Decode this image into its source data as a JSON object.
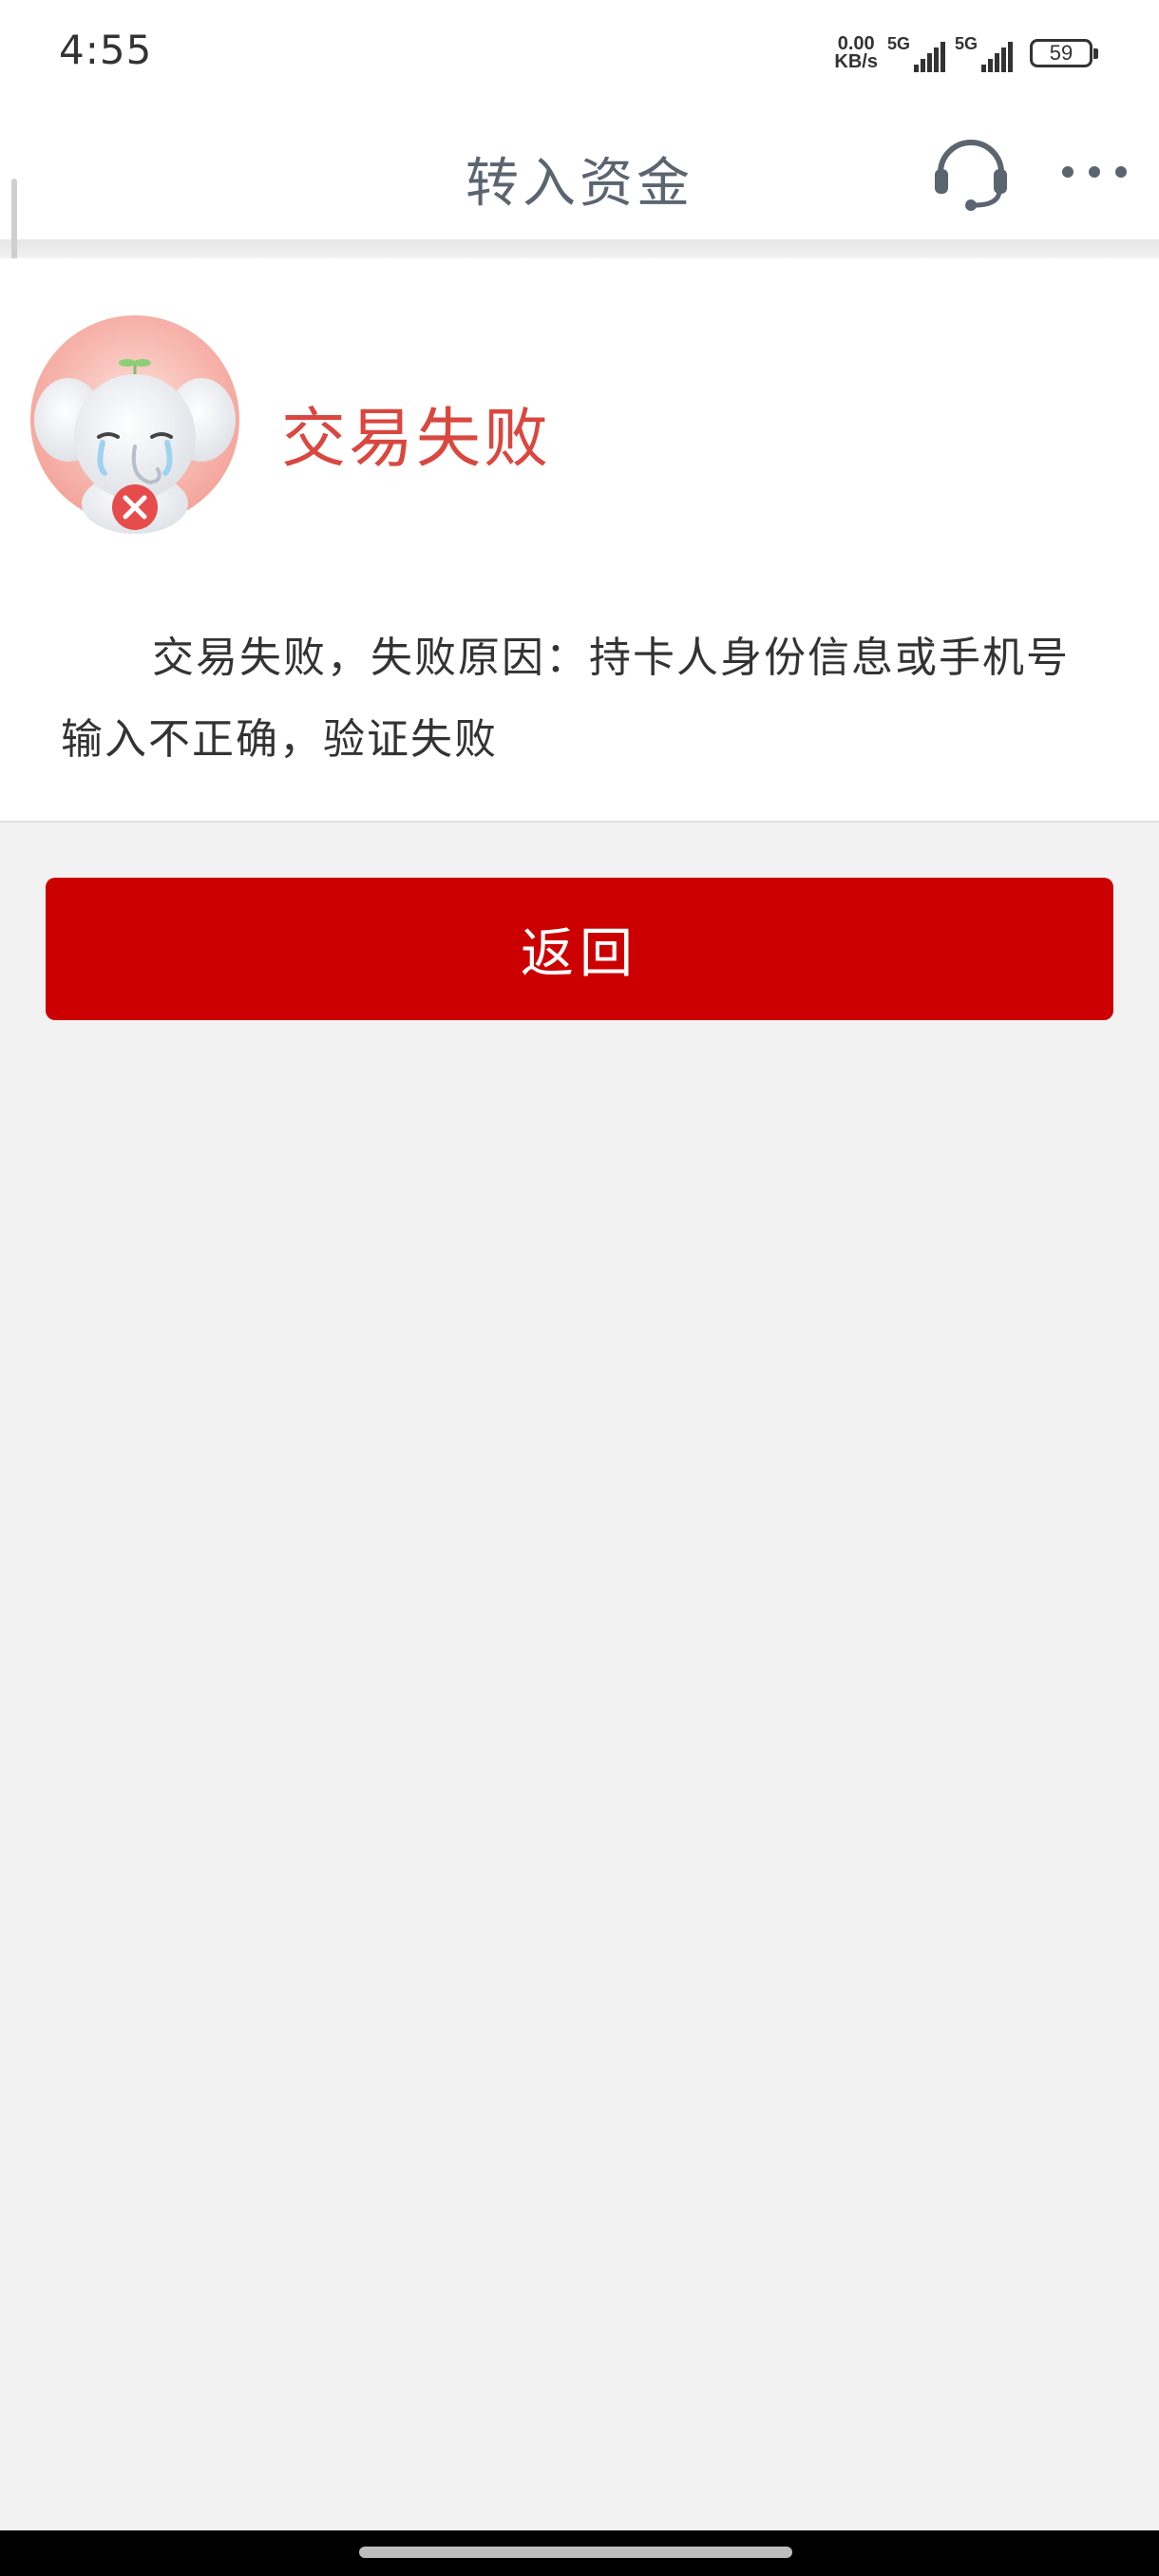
{
  "status_bar": {
    "time": "4:55",
    "net_speed_value": "0.00",
    "net_speed_unit": "KB/s",
    "sim1_label": "5G",
    "sim2_label": "5G",
    "battery_level": "59"
  },
  "nav": {
    "title": "转入资金",
    "support_icon": "headset-icon",
    "more_icon": "more-dots-icon"
  },
  "result": {
    "icon": "sad-elephant-failure-icon",
    "title": "交易失败",
    "message": "交易失败，失败原因：持卡人身份信息或手机号输入不正确，验证失败"
  },
  "actions": {
    "back_label": "返回"
  },
  "colors": {
    "accent": "#cc0000",
    "title_red": "#d9473f",
    "nav_title": "#5b6570",
    "background": "#f2f2f2"
  }
}
